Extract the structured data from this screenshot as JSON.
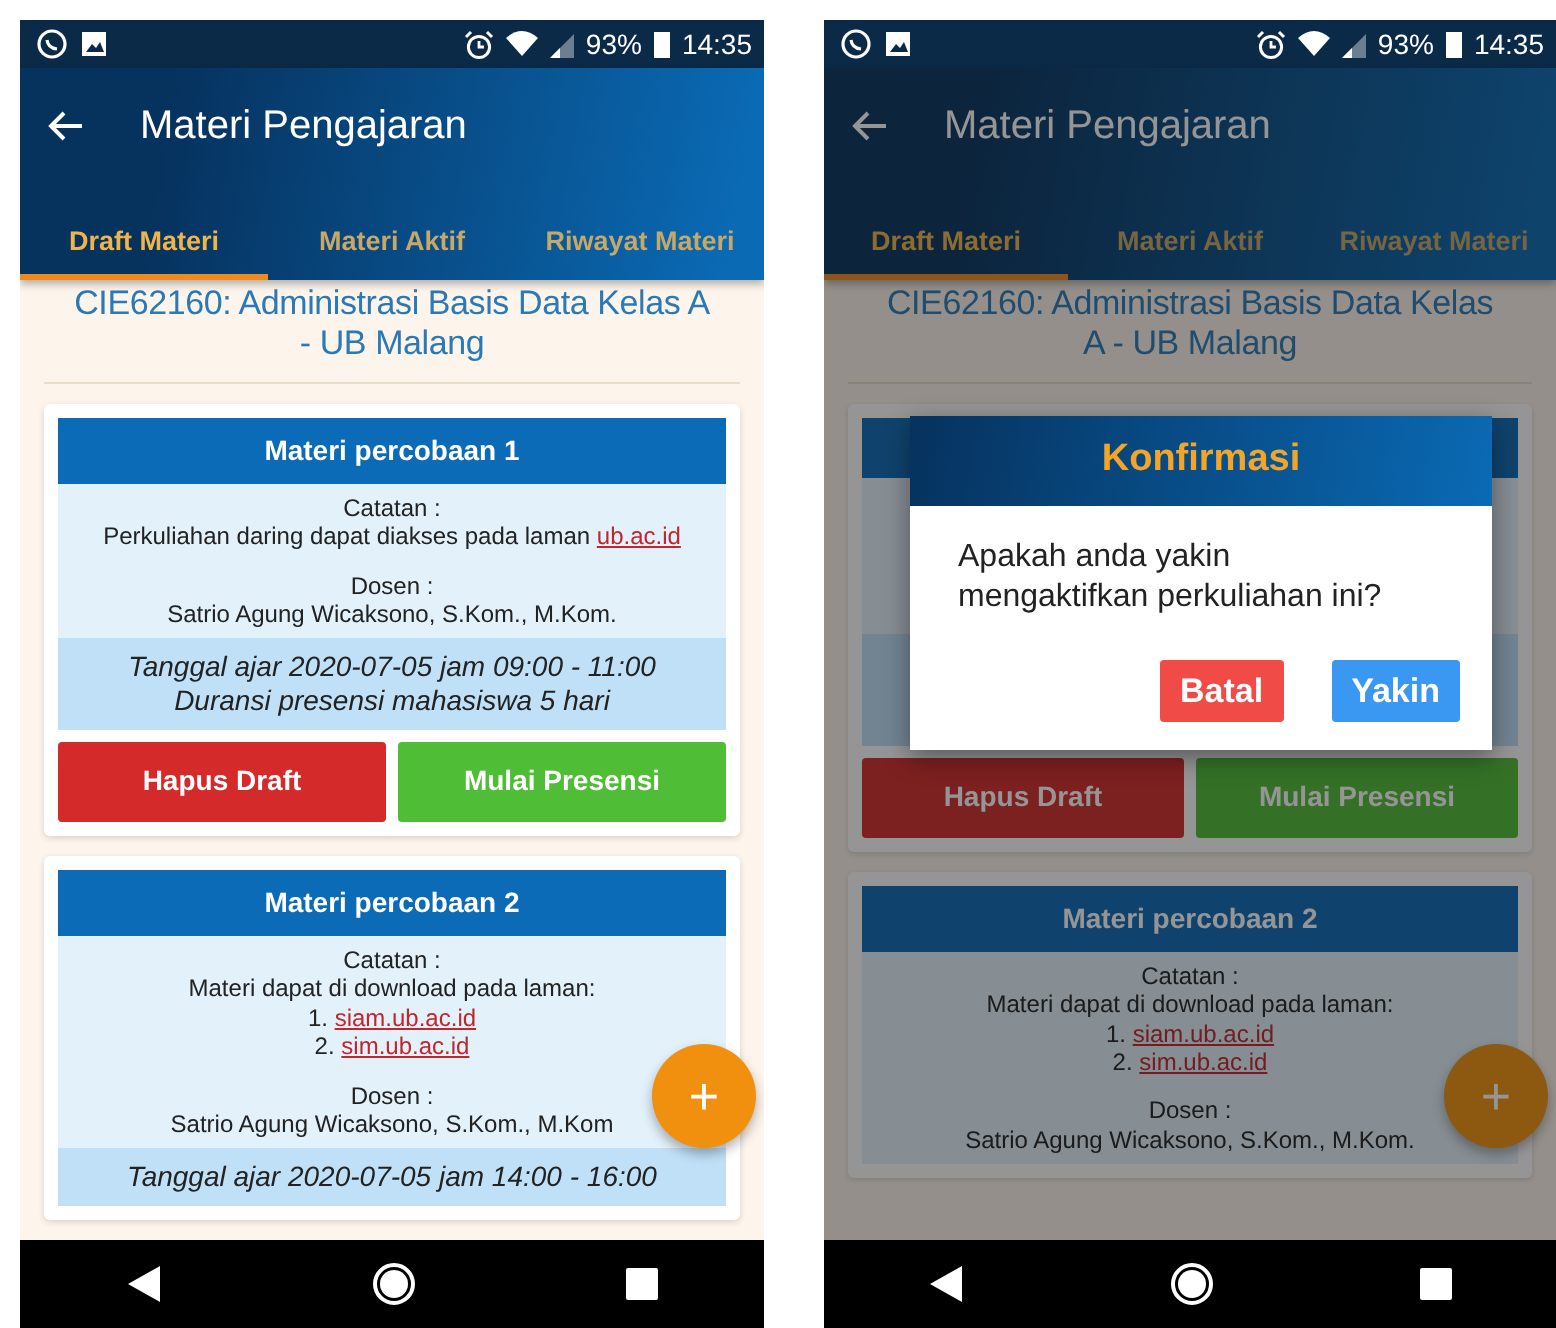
{
  "screens": [
    {
      "status_bar": {
        "battery": "93%",
        "time": "14:35"
      },
      "app_bar": {
        "title": "Materi Pengajaran"
      },
      "tabs": [
        {
          "label": "Draft Materi",
          "selected": true
        },
        {
          "label": "Materi Aktif",
          "selected": false
        },
        {
          "label": "Riwayat Materi",
          "selected": false
        }
      ],
      "course_title": "CIE62160: Administrasi Basis Data Kelas A - UB Malang",
      "cards": [
        {
          "title": "Materi percobaan 1",
          "notes_label": "Catatan :",
          "notes": [
            {
              "text": "Perkuliahan daring dapat diakses pada laman",
              "link": "ub.ac.id"
            }
          ],
          "lecturer_label": "Dosen :",
          "lecturer": "Satrio Agung Wicaksono, S.Kom., M.Kom.",
          "schedule": [
            "Tanggal ajar 2020-07-05 jam 09:00 - 11:00",
            "Duransi presensi mahasiswa 5 hari"
          ],
          "buttons": [
            {
              "label": "Hapus Draft",
              "kind": "delete"
            },
            {
              "label": "Mulai Presensi",
              "kind": "start"
            }
          ]
        },
        {
          "title": "Materi percobaan 2",
          "notes_label": "Catatan :",
          "notes": [
            {
              "text": "Materi dapat di download pada laman:"
            },
            {
              "text": "1.",
              "link": "siam.ub.ac.id"
            },
            {
              "text": "2.",
              "link": "sim.ub.ac.id"
            }
          ],
          "lecturer_label": "Dosen :",
          "lecturer": "Satrio Agung Wicaksono, S.Kom., M.Kom",
          "schedule": [
            "Tanggal ajar 2020-07-05 jam 14:00 - 16:00"
          ]
        }
      ],
      "fab": {
        "label": "+"
      }
    },
    {
      "status_bar": {
        "battery": "93%",
        "time": "14:35"
      },
      "app_bar": {
        "title": "Materi Pengajaran"
      },
      "tabs": [
        {
          "label": "Draft Materi",
          "selected": true
        },
        {
          "label": "Materi Aktif",
          "selected": false
        },
        {
          "label": "Riwayat Materi",
          "selected": false
        }
      ],
      "course_title": "CIE62160: Administrasi Basis Data Kelas A - UB Malang",
      "cards": [
        {
          "buttons": [
            {
              "label": "Hapus Draft",
              "kind": "delete"
            },
            {
              "label": "Mulai Presensi",
              "kind": "start"
            }
          ]
        },
        {
          "title": "Materi percobaan 2",
          "notes_label": "Catatan :",
          "notes": [
            {
              "text": "Materi dapat di download pada laman:"
            },
            {
              "text": "1.",
              "link": "siam.ub.ac.id"
            },
            {
              "text": "2.",
              "link": "sim.ub.ac.id"
            }
          ],
          "lecturer_label": "Dosen :",
          "lecturer": "Satrio Agung Wicaksono, S.Kom., M.Kom."
        }
      ],
      "fab": {
        "label": "+"
      },
      "dialog": {
        "title": "Konfirmasi",
        "message": "Apakah anda yakin mengaktifkan perkuliahan ini?",
        "buttons": [
          {
            "label": "Batal",
            "kind": "cancel"
          },
          {
            "label": "Yakin",
            "kind": "confirm"
          }
        ]
      }
    }
  ]
}
